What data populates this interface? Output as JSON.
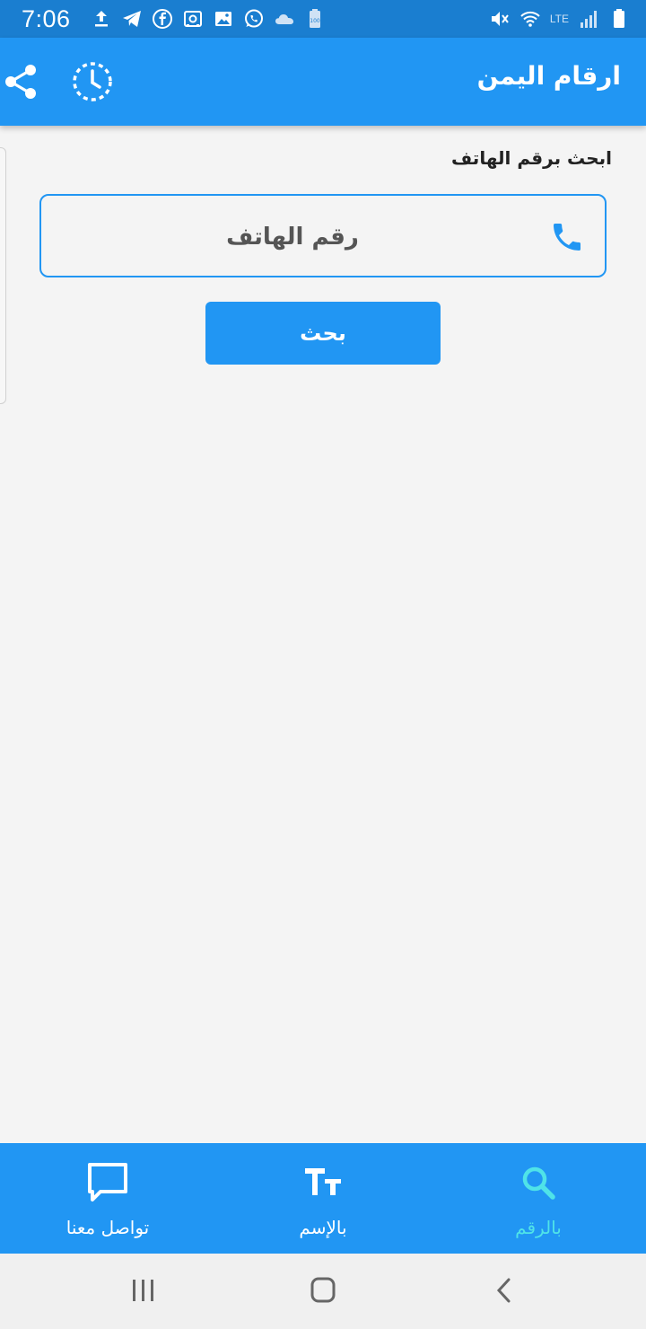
{
  "status_bar": {
    "time": "7:06",
    "battery_label": "100",
    "left_icons": [
      "upload-icon",
      "telegram-icon",
      "facebook-icon",
      "vpn-icon",
      "gallery-icon",
      "whatsapp-icon",
      "cloud-icon",
      "battery-saver-icon"
    ],
    "right_icons": [
      "mute-icon",
      "wifi-icon",
      "volte-icon",
      "signal-icon",
      "battery-icon"
    ],
    "volte_label": "LTE"
  },
  "app_bar": {
    "title": "ارقام اليمن",
    "icons": [
      "share-icon",
      "history-icon"
    ]
  },
  "search": {
    "section_label": "ابحث برقم الهاتف",
    "phone_placeholder": "رقم الهاتف",
    "phone_value": "",
    "button_label": "بحث"
  },
  "bottom_nav": {
    "active": "by_number",
    "items": [
      {
        "key": "contact",
        "label": "تواصل معنا",
        "icon": "chat-icon"
      },
      {
        "key": "by_name",
        "label": "بالإسم",
        "icon": "text-size-icon"
      },
      {
        "key": "by_number",
        "label": "بالرقم",
        "icon": "search-icon"
      }
    ]
  },
  "colors": {
    "primary": "#2196f3",
    "status_bar": "#1a7ed0",
    "active_nav": "#4fe3e8",
    "background": "#f4f4f4"
  }
}
